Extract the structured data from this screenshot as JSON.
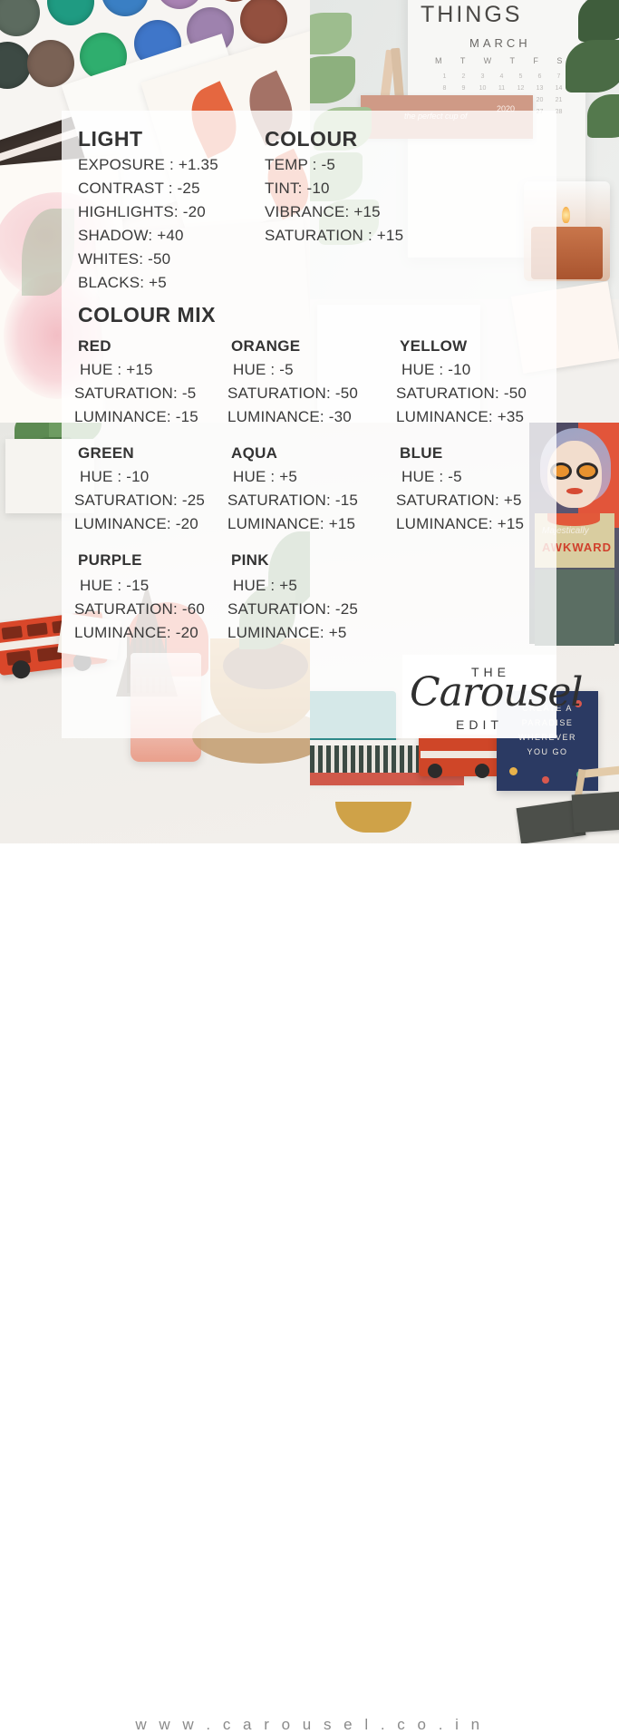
{
  "footer": {
    "url": "w w w . c a r o u s e l . c o . i n"
  },
  "logo": {
    "the": "THE",
    "script": "Carousel",
    "edit": "EDIT"
  },
  "sections": {
    "light": {
      "title": "LIGHT",
      "rows": [
        "EXPOSURE : +1.35",
        "CONTRAST :  -25",
        "HIGHLIGHTS: -20",
        "SHADOW: +40",
        "WHITES: -50",
        "BLACKS: +5"
      ]
    },
    "colour": {
      "title": "COLOUR",
      "rows": [
        "TEMP : -5",
        "TINT: -10",
        "VIBRANCE: +15",
        "SATURATION : +15"
      ]
    },
    "colour_mix": {
      "title": "COLOUR MIX",
      "groups": [
        {
          "name": "RED",
          "hue": "HUE : +15",
          "saturation": "SATURATION: -5",
          "luminance": "LUMINANCE: -15"
        },
        {
          "name": "ORANGE",
          "hue": "HUE : -5",
          "saturation": "SATURATION: -50",
          "luminance": "LUMINANCE: -30"
        },
        {
          "name": "YELLOW",
          "hue": "HUE : -10",
          "saturation": "SATURATION: -50",
          "luminance": "LUMINANCE: +35"
        },
        {
          "name": "GREEN",
          "hue": "HUE : -10",
          "saturation": "SATURATION: -25",
          "luminance": "LUMINANCE: -20"
        },
        {
          "name": "AQUA",
          "hue": "HUE : +5",
          "saturation": "SATURATION: -15",
          "luminance": "LUMINANCE: +15"
        },
        {
          "name": "BLUE",
          "hue": "HUE : -5",
          "saturation": "SATURATION: +5",
          "luminance": "LUMINANCE: +15"
        },
        {
          "name": "PURPLE",
          "hue": "HUE : -15",
          "saturation": "SATURATION: -60",
          "luminance": "LUMINANCE: -20"
        },
        {
          "name": "PINK",
          "hue": "HUE : +5",
          "saturation": "SATURATION: -25",
          "luminance": "LUMINANCE: +5"
        }
      ]
    }
  },
  "photos": {
    "top_left": {
      "subject": "watercolour paint palette and botanical art prints"
    },
    "top_right": {
      "calendar_title": "THINGS",
      "calendar_month": "MARCH",
      "calendar_dow": "M T W T F S",
      "card_note": "the perfect cup of",
      "card_year": "2020"
    },
    "bottom_left": {
      "subject": "red london bus, eiffel tower figurine, pink drink, wooden bowl"
    },
    "bottom_right": {
      "poster_line1": "Majestically",
      "poster_line2": "AWKWARD",
      "card_line1": "CREATE A",
      "card_line2": "PARADISE",
      "card_line3": "WHEREVER",
      "card_line4": "YOU GO"
    }
  },
  "colors": {
    "text": "#3d3d3d",
    "panel": "rgba(255,255,255,0.80)",
    "footer_text": "#8a8a8a"
  }
}
